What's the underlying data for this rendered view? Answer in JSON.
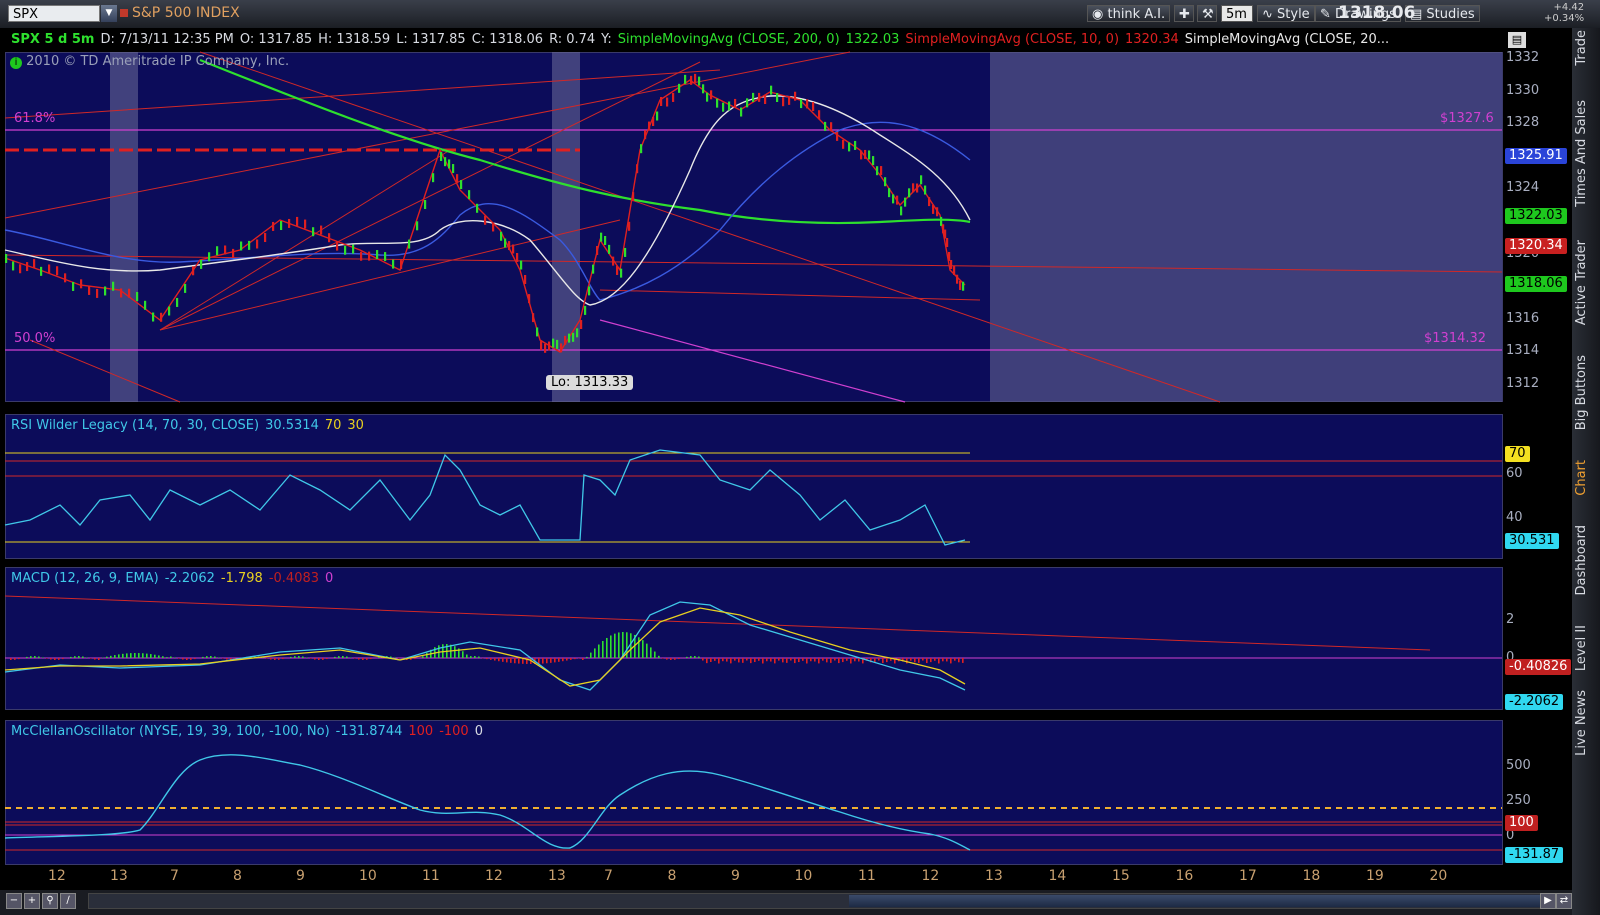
{
  "toolbar": {
    "symbol": "SPX",
    "symbol_name": "S&P 500 INDEX",
    "think_ai": "think A.I.",
    "interval": "5m",
    "style": "Style",
    "drawings": "Drawings",
    "studies": "Studies",
    "last_price": "1318.06",
    "change_abs": "+4.42",
    "change_pct": "+0.34%"
  },
  "price_header": {
    "title": "SPX 5 d 5m",
    "date": "D: 7/13/11 12:35 PM",
    "open": "O: 1317.85",
    "high": "H: 1318.59",
    "low": "L: 1317.85",
    "close": "C: 1318.06",
    "range": "R: 0.74",
    "y": "Y:",
    "sma200": "SimpleMovingAvg (CLOSE, 200, 0)",
    "sma200_val": "1322.03",
    "sma10": "SimpleMovingAvg (CLOSE, 10, 0)",
    "sma10_val": "1320.34",
    "sma_other": "SimpleMovingAvg (CLOSE, 20...",
    "copyright": "2010 © TD Ameritrade IP Company, Inc."
  },
  "price_axis": {
    "ticks": [
      "1332",
      "1330",
      "1328",
      "1326",
      "1324",
      "1322",
      "1320",
      "1318",
      "1316",
      "1314",
      "1312"
    ],
    "badges": [
      {
        "text": "1325.91",
        "bg": "#2a44d8",
        "fg": "#ffffff"
      },
      {
        "text": "1322.03",
        "bg": "#1ec81e",
        "fg": "#000000"
      },
      {
        "text": "1320.34",
        "bg": "#c82020",
        "fg": "#ffffff"
      },
      {
        "text": "1318.06",
        "bg": "#1ec81e",
        "fg": "#000000"
      }
    ]
  },
  "fib": {
    "upper_pct": "61.8%",
    "upper_price": "$1327.6",
    "lower_pct": "50.0%",
    "lower_price": "$1314.32",
    "low_label": "Lo: 1313.33"
  },
  "rsi": {
    "title": "RSI Wilder Legacy (14, 70, 30, CLOSE)",
    "value": "30.5314",
    "ob": "70",
    "os": "30",
    "ticks": [
      "60",
      "40"
    ],
    "badge_ob": "70",
    "badge_val": "30.531"
  },
  "macd": {
    "title": "MACD (12, 26, 9, EMA)",
    "value": "-2.2062",
    "avg": "-1.798",
    "diff": "-0.4083",
    "zero": "0",
    "ticks": [
      "2",
      "0"
    ],
    "badge_diff": "-0.40826",
    "badge_val": "-2.2062"
  },
  "mcclellan": {
    "title": "McClellanOscillator (NYSE, 19, 39, 100, -100, No)",
    "value": "-131.8744",
    "upper": "100",
    "lower": "-100",
    "zero": "0",
    "ticks": [
      "500",
      "250",
      "0"
    ],
    "badge_upper": "100",
    "badge_val": "-131.87"
  },
  "x_axis": [
    "12",
    "13",
    "7",
    "8",
    "9",
    "10",
    "11",
    "12",
    "13",
    "7",
    "8",
    "9",
    "10",
    "11",
    "12",
    "13",
    "14",
    "15",
    "16",
    "17",
    "18",
    "19",
    "20"
  ],
  "side_tabs": [
    "Trade",
    "Times And Sales",
    "Active Trader",
    "Big Buttons",
    "Chart",
    "Dashboard",
    "Level II",
    "Live News"
  ],
  "colors": {
    "pane_bg": "#0c0c5a",
    "sma200": "#2ee02e",
    "sma10": "#e02020",
    "white_ma": "#e8e8e8",
    "blue_ma": "#3a5ae0",
    "fib": "#d040d0",
    "rsi_line": "#40c8e8",
    "signal": "#e8d020"
  }
}
